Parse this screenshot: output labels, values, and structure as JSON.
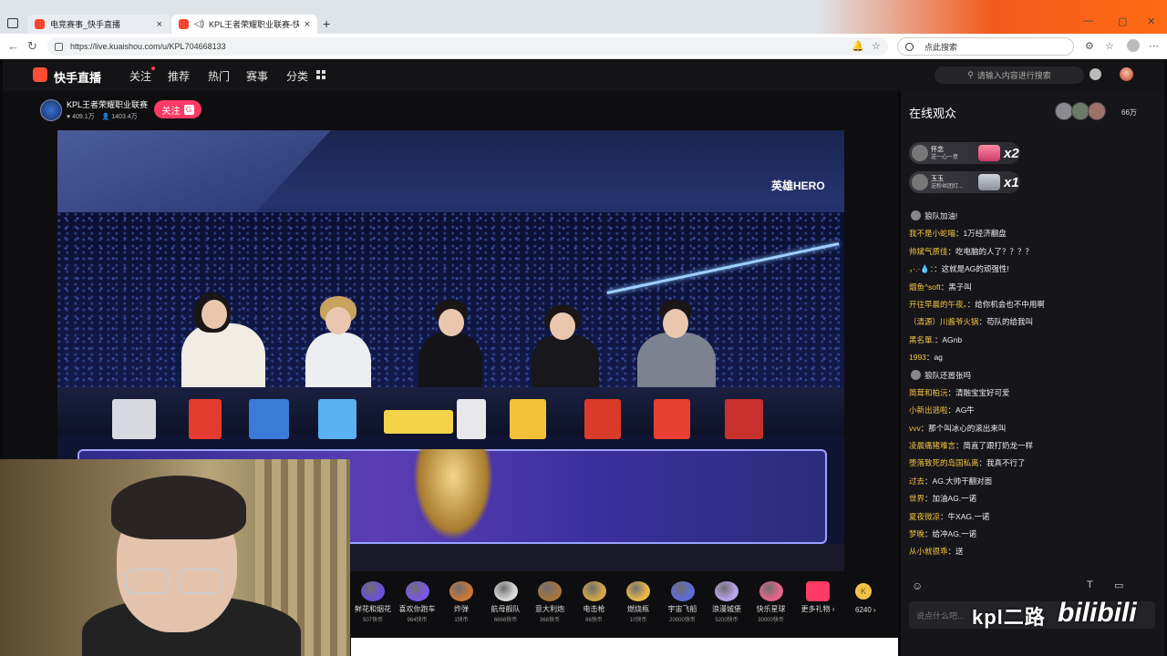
{
  "browser": {
    "tabs": [
      {
        "title": "电竞赛事_快手直播"
      },
      {
        "title": "KPL王者荣耀职业联赛-快手直"
      }
    ],
    "url": "https://live.kuaishou.com/u/KPL704668133",
    "search_placeholder": "点此搜索"
  },
  "site": {
    "logo_text": "快手直播",
    "nav": [
      "关注",
      "推荐",
      "热门",
      "赛事",
      "分类"
    ],
    "search_placeholder": "请输入内容进行搜索"
  },
  "streamer": {
    "name": "KPL王者荣耀职业联赛",
    "likes": "409.1万",
    "fans": "1403.4万",
    "follow_label": "关注"
  },
  "video": {
    "watermark": "英雄HERO"
  },
  "gifts": [
    {
      "name": "鲜花和烟花",
      "price": "507快币",
      "color": "#6b4fd8"
    },
    {
      "name": "喜欢你跑车",
      "price": "964快币",
      "color": "#7a58e8"
    },
    {
      "name": "炸弹",
      "price": "1快币",
      "color": "#c9773a"
    },
    {
      "name": "航母舰队",
      "price": "6666快币",
      "color": "#d9d9d9"
    },
    {
      "name": "意大利炮",
      "price": "366快币",
      "color": "#a8743f"
    },
    {
      "name": "电击枪",
      "price": "66快币",
      "color": "#d4a64a"
    },
    {
      "name": "燃烧瓶",
      "price": "10快币",
      "color": "#e7b84a"
    },
    {
      "name": "宇宙飞船",
      "price": "20000快币",
      "color": "#5e6bd8"
    },
    {
      "name": "浪漫城堡",
      "price": "5200快币",
      "color": "#b9a3e8"
    },
    {
      "name": "快乐星球",
      "price": "30000快币",
      "color": "#e6658a"
    }
  ],
  "more_gifts_label": "更多礼物",
  "coin_balance": "6240",
  "side": {
    "title": "在线观众",
    "viewer_count": "66万",
    "gift_banners": [
      {
        "user": "怀念",
        "text": "送一心一意",
        "count": "x2"
      },
      {
        "user": "玉玉",
        "text": "送粉丝团灯...",
        "count": "x1"
      }
    ],
    "chat": [
      {
        "user": "",
        "text": "狼队加油!"
      },
      {
        "user": "我不是小蛇喵",
        "text": "1万经济翻盘"
      },
      {
        "user": "帅斌气质佳",
        "text": "吃电脑的人了？？？？"
      },
      {
        "user": "，·.·💧：",
        "text": "这就是AG的顽强性!"
      },
      {
        "user": "烟鱼^soft",
        "text": "黑子叫"
      },
      {
        "user": "开往早晨的午夜。",
        "text": "给你机会也不中用啊"
      },
      {
        "user": "（清源）川酱爷火锅",
        "text": "苟队的给我叫"
      },
      {
        "user": "黑名單.",
        "text": "AGnb"
      },
      {
        "user": "1993",
        "text": "ag"
      },
      {
        "user": "",
        "text": "狼队还嚣张吗"
      },
      {
        "user": "简茸和柏沅",
        "text": "清融宝宝好可爱"
      },
      {
        "user": "小新出逃啦",
        "text": "AG牛"
      },
      {
        "user": "vvv",
        "text": "那个叫冰心的滚出来叫"
      },
      {
        "user": "凌晨痛猪难言",
        "text": "简直了跟打奶龙一样"
      },
      {
        "user": "堕落致死的岛国私离",
        "text": "我真不行了"
      },
      {
        "user": "过去",
        "text": "AG.大帅干翻对面"
      },
      {
        "user": "世界",
        "text": "加油AG.一诺"
      },
      {
        "user": "夏夜微凉",
        "text": "牛XAG.一诺"
      },
      {
        "user": "梦晚",
        "text": "给冲AG.一诺"
      },
      {
        "user": "从小就很乖",
        "text": "送"
      }
    ],
    "input_placeholder": "说点什么吧..."
  },
  "overlay": {
    "watermark_text": "kpl二路",
    "bili_text": "bilibili"
  }
}
